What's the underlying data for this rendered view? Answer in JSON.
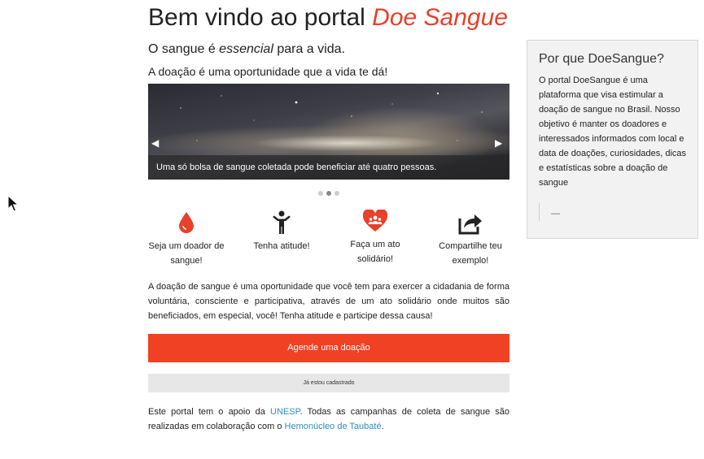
{
  "header": {
    "title_prefix": "Bem vindo ao portal ",
    "title_brand": "Doe Sangue",
    "subtitle_before": "O sangue é ",
    "subtitle_emph": "essencial",
    "subtitle_after": " para a vida.",
    "tagline": "A doação é uma oportunidade que a vida te dá!"
  },
  "carousel": {
    "caption": "Uma só bolsa de sangue coletada pode beneficiar até quatro pessoas.",
    "prev_icon": "chevron-left-icon",
    "next_icon": "chevron-right-icon",
    "slide_count": 3,
    "active_slide": 2
  },
  "features": [
    {
      "icon": "blood-drop-icon",
      "label": "Seja um doador de sangue!"
    },
    {
      "icon": "person-icon",
      "label": "Tenha atitude!"
    },
    {
      "icon": "heart-group-icon",
      "label": "Faça um ato solidário!"
    },
    {
      "icon": "share-icon",
      "label": "Compartilhe teu exemplo!"
    }
  ],
  "body": {
    "text": "A doação de sangue é uma oportunidade que você tem para exercer a cidadania de forma voluntária, consciente e participativa, através de um ato solidário onde muitos são beneficiados, em especial, você! Tenha atitude e participe dessa causa!"
  },
  "actions": {
    "primary_label": "Agende uma doação",
    "secondary_label": "Já estou cadastrado"
  },
  "footer": {
    "text_1": "Este portal tem o apoio da ",
    "link_1": "UNESP",
    "text_2": ". Todas as campanhas de coleta de sangue são realizadas em colaboração com o ",
    "link_2": "Hemonúcleo de Taubaté",
    "text_3": "."
  },
  "sidebar": {
    "title": "Por que DoeSangue?",
    "text": "O portal DoeSangue é uma plataforma que visa estimular a doação de sangue no Brasil. Nosso objetivo é manter os doadores e interessados informados com local e data de doações, curiosidades, dicas e estatísticas sobre a doação de sangue",
    "quote": "—"
  },
  "colors": {
    "brand": "#e8402a",
    "primary_button": "#f04124",
    "link": "#2a8fbd"
  }
}
